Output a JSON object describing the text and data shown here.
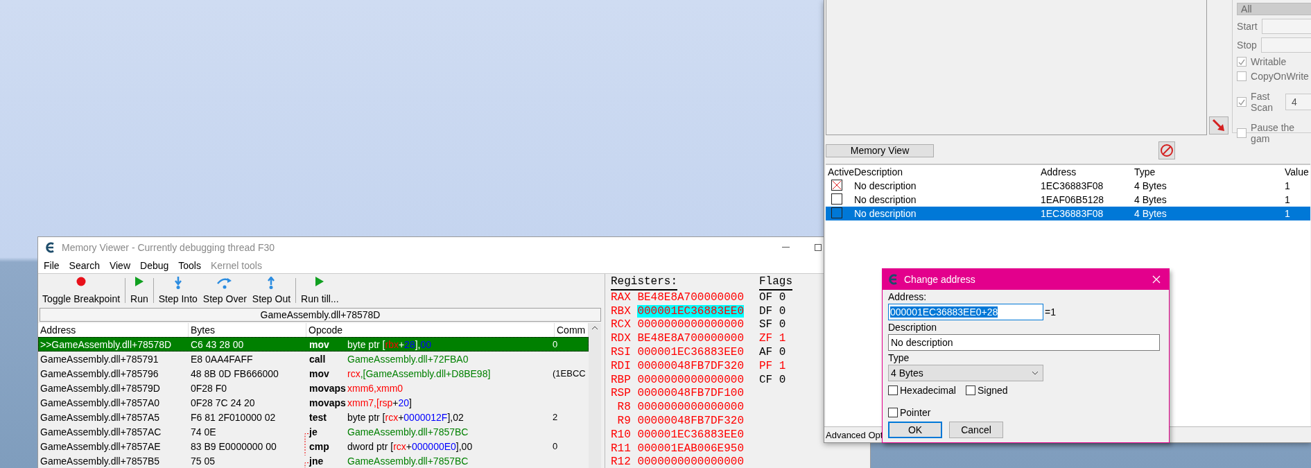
{
  "memory_viewer": {
    "title": "Memory Viewer - Currently debugging thread F30",
    "menu": [
      {
        "label": "File",
        "disabled": false
      },
      {
        "label": "Search",
        "disabled": false
      },
      {
        "label": "View",
        "disabled": false
      },
      {
        "label": "Debug",
        "disabled": false
      },
      {
        "label": "Tools",
        "disabled": false
      },
      {
        "label": "Kernel tools",
        "disabled": true
      }
    ],
    "toolbar_groups": [
      [
        {
          "label": "Toggle Breakpoint",
          "kind": "breakpoint"
        }
      ],
      [
        {
          "label": "Run",
          "kind": "run"
        }
      ],
      [
        {
          "label": "Step Into",
          "kind": "step_into"
        },
        {
          "label": "Step Over",
          "kind": "step_over"
        },
        {
          "label": "Step Out",
          "kind": "step_out"
        }
      ],
      [
        {
          "label": "Run till...",
          "kind": "run"
        }
      ]
    ],
    "address_bar": "GameAssembly.dll+78578D",
    "columns": [
      "Address",
      "Bytes",
      "Opcode",
      "Comm"
    ],
    "rows": [
      {
        "address": ">>GameAssembly.dll+78578D",
        "bytes": "C6 43 28 00",
        "mnemonic": "mov",
        "operand": [
          {
            "kind": "plain",
            "text": "byte ptr ["
          },
          {
            "kind": "register",
            "text": "rbx"
          },
          {
            "kind": "plain",
            "text": "+"
          },
          {
            "kind": "number",
            "text": "28"
          },
          {
            "kind": "plain",
            "text": "],"
          },
          {
            "kind": "number",
            "text": "00"
          }
        ],
        "comment": "0",
        "selected": true
      },
      {
        "address": "GameAssembly.dll+785791",
        "bytes": "E8 0AA4FAFF",
        "mnemonic": "call",
        "operand": [
          {
            "kind": "symbol",
            "text": "GameAssembly.dll+72FBA0"
          }
        ],
        "comment": "",
        "selected": false
      },
      {
        "address": "GameAssembly.dll+785796",
        "bytes": "48 8B 0D FB666000",
        "mnemonic": "mov",
        "operand": [
          {
            "kind": "register",
            "text": "rcx"
          },
          {
            "kind": "symbol",
            "text": ",[GameAssembly.dll+D8BE98]"
          }
        ],
        "comment": "(1EBCC",
        "selected": false
      },
      {
        "address": "GameAssembly.dll+78579D",
        "bytes": "0F28 F0",
        "mnemonic": "movaps",
        "operand": [
          {
            "kind": "register",
            "text": "xmm6,xmm0"
          }
        ],
        "comment": "",
        "selected": false
      },
      {
        "address": "GameAssembly.dll+7857A0",
        "bytes": "0F28 7C 24 20",
        "mnemonic": "movaps",
        "operand": [
          {
            "kind": "register",
            "text": "xmm7,[rsp"
          },
          {
            "kind": "plain",
            "text": "+"
          },
          {
            "kind": "number",
            "text": "20"
          },
          {
            "kind": "plain",
            "text": "]"
          }
        ],
        "comment": "",
        "selected": false
      },
      {
        "address": "GameAssembly.dll+7857A5",
        "bytes": "F6 81 2F010000 02",
        "mnemonic": "test",
        "operand": [
          {
            "kind": "plain",
            "text": "byte ptr ["
          },
          {
            "kind": "register",
            "text": "rcx"
          },
          {
            "kind": "plain",
            "text": "+"
          },
          {
            "kind": "number",
            "text": "0000012F"
          },
          {
            "kind": "plain",
            "text": "],02"
          }
        ],
        "comment": "2",
        "selected": false
      },
      {
        "address": "GameAssembly.dll+7857AC",
        "bytes": "74 0E",
        "mnemonic": "je",
        "operand": [
          {
            "kind": "symbol",
            "text": "GameAssembly.dll+7857BC"
          }
        ],
        "comment": "",
        "selected": false,
        "kind": "jump"
      },
      {
        "address": "GameAssembly.dll+7857AE",
        "bytes": "83 B9 E0000000 00",
        "mnemonic": "cmp",
        "operand": [
          {
            "kind": "plain",
            "text": "dword ptr ["
          },
          {
            "kind": "register",
            "text": "rcx"
          },
          {
            "kind": "plain",
            "text": "+"
          },
          {
            "kind": "number",
            "text": "000000E0"
          },
          {
            "kind": "plain",
            "text": "],00"
          }
        ],
        "comment": "0",
        "selected": false,
        "kind": "passthrough"
      },
      {
        "address": "GameAssembly.dll+7857B5",
        "bytes": "75 05",
        "mnemonic": "jne",
        "operand": [
          {
            "kind": "symbol",
            "text": "GameAssembly.dll+7857BC"
          }
        ],
        "comment": "",
        "selected": false,
        "kind": "jump"
      }
    ],
    "registers_title": "Registers:",
    "flags_title": "Flags",
    "registers": [
      {
        "name": "RAX",
        "value": "BE48E8A700000000",
        "selected": false
      },
      {
        "name": "RBX",
        "value": "000001EC36883EE0",
        "selected": true
      },
      {
        "name": "RCX",
        "value": "0000000000000000",
        "selected": false
      },
      {
        "name": "RDX",
        "value": "BE48E8A700000000",
        "selected": false
      },
      {
        "name": "RSI",
        "value": "000001EC36883EE0",
        "selected": false
      },
      {
        "name": "RDI",
        "value": "00000048FB7DF320",
        "selected": false
      },
      {
        "name": "RBP",
        "value": "0000000000000000",
        "selected": false
      },
      {
        "name": "RSP",
        "value": "00000048FB7DF100",
        "selected": false
      },
      {
        "name": "R8",
        "value": "0000000000000000",
        "selected": false
      },
      {
        "name": "R9",
        "value": "00000048FB7DF320",
        "selected": false
      },
      {
        "name": "R10",
        "value": "000001EC36883EE0",
        "selected": false
      },
      {
        "name": "R11",
        "value": "000001EAB006E950",
        "selected": false
      },
      {
        "name": "R12",
        "value": "0000000000000000",
        "selected": false
      }
    ],
    "flags": [
      {
        "name": "OF",
        "value": "0",
        "changed": false
      },
      {
        "name": "DF",
        "value": "0",
        "changed": false
      },
      {
        "name": "SF",
        "value": "0",
        "changed": false
      },
      {
        "name": "ZF",
        "value": "1",
        "changed": true
      },
      {
        "name": "AF",
        "value": "0",
        "changed": false
      },
      {
        "name": "PF",
        "value": "1",
        "changed": true
      },
      {
        "name": "CF",
        "value": "0",
        "changed": false
      }
    ]
  },
  "main_window": {
    "memory_type": "All",
    "start_label": "Start",
    "stop_label": "Stop",
    "options": [
      {
        "label": "Writable",
        "checked": true
      },
      {
        "label": "CopyOnWrite",
        "checked": false
      },
      {
        "label": "Fast Scan",
        "checked": true,
        "value": "4"
      },
      {
        "label": "Pause the gam",
        "checked": false
      }
    ],
    "memory_view_button": "Memory View",
    "address_list": {
      "columns": [
        "Active",
        "Description",
        "Address",
        "Type",
        "Value"
      ],
      "rows": [
        {
          "active": true,
          "selected": false,
          "description": "No description",
          "address": "1EC36883F08",
          "type": "4 Bytes",
          "value": "1"
        },
        {
          "active": false,
          "selected": false,
          "description": "No description",
          "address": "1EAF06B5128",
          "type": "4 Bytes",
          "value": "1"
        },
        {
          "active": false,
          "selected": true,
          "description": "No description",
          "address": "1EC36883F08",
          "type": "4 Bytes",
          "value": "1"
        }
      ]
    },
    "advanced_options": "Advanced Opt"
  },
  "dialog": {
    "title": "Change address",
    "address_label": "Address:",
    "address_value": "000001EC36883EE0+28",
    "address_result": "=1",
    "description_label": "Description",
    "description_value": "No description",
    "type_label": "Type",
    "type_value": "4 Bytes",
    "checks": [
      {
        "label": "Hexadecimal",
        "checked": false
      },
      {
        "label": "Signed",
        "checked": false
      },
      {
        "label": "Pointer",
        "checked": false
      }
    ],
    "buttons": [
      {
        "label": "OK",
        "default": true
      },
      {
        "label": "Cancel",
        "default": false
      }
    ]
  }
}
